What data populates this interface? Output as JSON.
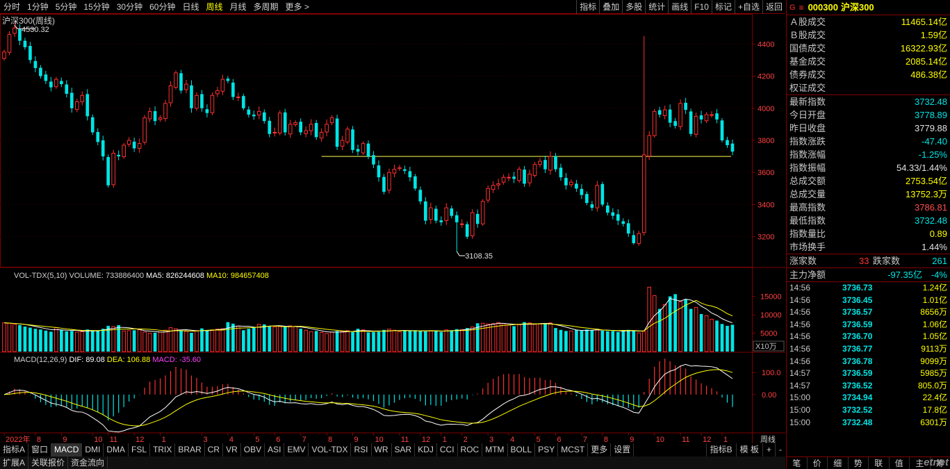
{
  "toolbar": {
    "periods": [
      "分时",
      "1分钟",
      "5分钟",
      "15分钟",
      "30分钟",
      "60分钟",
      "日线",
      "周线",
      "月线",
      "多周期",
      "更多 >"
    ],
    "active_period": "周线",
    "tools": [
      "指标",
      "叠加",
      "多股",
      "统计",
      "画线",
      "F10",
      "标记",
      "+自选",
      "返回"
    ]
  },
  "chart": {
    "title": "沪深300(周线)",
    "high_label": "4530.32",
    "low_label": "3108.35",
    "period_label": "周线",
    "unit_label": "X10万",
    "vol_legend": {
      "name": "VOL-TDX(5,10)",
      "volume": "VOLUME: 733886400",
      "ma5": "MA5: 826244608",
      "ma10": "MA10: 984657408"
    },
    "macd_legend": {
      "name": "MACD(12,26,9)",
      "dif": "DIF: 89.08",
      "dea": "DEA: 106.88",
      "macd": "MACD: -35.60"
    },
    "x_labels": [
      {
        "t": "2022年",
        "i": 0
      },
      {
        "t": "8",
        "i": 6
      },
      {
        "t": "9",
        "i": 11
      },
      {
        "t": "10",
        "i": 17
      },
      {
        "t": "11",
        "i": 20
      },
      {
        "t": "12",
        "i": 25
      },
      {
        "t": "1",
        "i": 30
      },
      {
        "t": "3",
        "i": 38
      },
      {
        "t": "4",
        "i": 43
      },
      {
        "t": "5",
        "i": 48
      },
      {
        "t": "6",
        "i": 52
      },
      {
        "t": "7",
        "i": 57
      },
      {
        "t": "8",
        "i": 62
      },
      {
        "t": "9",
        "i": 67
      },
      {
        "t": "10",
        "i": 71
      },
      {
        "t": "11",
        "i": 76
      },
      {
        "t": "12",
        "i": 80
      },
      {
        "t": "1",
        "i": 84
      },
      {
        "t": "2",
        "i": 88
      },
      {
        "t": "3",
        "i": 93
      },
      {
        "t": "4",
        "i": 97
      },
      {
        "t": "5",
        "i": 102
      },
      {
        "t": "6",
        "i": 106
      },
      {
        "t": "7",
        "i": 111
      },
      {
        "t": "8",
        "i": 115
      },
      {
        "t": "9",
        "i": 120
      },
      {
        "t": "10",
        "i": 125
      },
      {
        "t": "11",
        "i": 130
      },
      {
        "t": "12",
        "i": 134
      },
      {
        "t": "1",
        "i": 138
      }
    ],
    "price_ticks": [
      3200,
      3400,
      3600,
      3800,
      4000,
      4200,
      4400
    ],
    "vol_ticks": [
      5000,
      10000,
      15000
    ],
    "macd_ticks": [
      "0.00",
      "100.0"
    ]
  },
  "chart_data": {
    "type": "candlestick",
    "price_range": [
      3030,
      4570
    ],
    "closes": [
      4350,
      4460,
      4500,
      4420,
      4380,
      4300,
      4250,
      4200,
      4170,
      4130,
      4180,
      4150,
      4090,
      4000,
      4040,
      4080,
      3950,
      3850,
      3790,
      3700,
      3520,
      3720,
      3700,
      3770,
      3800,
      3750,
      3780,
      3940,
      3980,
      3920,
      3940,
      4030,
      4140,
      4220,
      4110,
      4150,
      4000,
      4080,
      4000,
      3970,
      4080,
      4110,
      4180,
      4170,
      4070,
      4070,
      4000,
      3960,
      3950,
      3980,
      3920,
      3840,
      3850,
      3970,
      3850,
      3900,
      3910,
      3850,
      3860,
      3900,
      3820,
      3850,
      3900,
      3940,
      3760,
      3800,
      3870,
      3740,
      3730,
      3780,
      3700,
      3650,
      3570,
      3480,
      3600,
      3620,
      3630,
      3610,
      3570,
      3500,
      3420,
      3300,
      3380,
      3300,
      3290,
      3380,
      3330,
      3290,
      3280,
      3200,
      3350,
      3280,
      3420,
      3500,
      3520,
      3530,
      3570,
      3570,
      3560,
      3620,
      3530,
      3590,
      3650,
      3670,
      3620,
      3700,
      3620,
      3570,
      3520,
      3540,
      3500,
      3460,
      3410,
      3380,
      3520,
      3400,
      3350,
      3330,
      3300,
      3280,
      3220,
      3160,
      3220,
      3710,
      3830,
      3980,
      3960,
      3990,
      3910,
      3890,
      4030,
      3990,
      3840,
      3950,
      3930,
      3960,
      3960,
      3930,
      3800,
      3770,
      3730
    ],
    "volumes": [
      7800,
      7700,
      7400,
      7200,
      6800,
      6500,
      6200,
      6000,
      5700,
      5400,
      6500,
      5900,
      5500,
      5600,
      5300,
      5400,
      6000,
      5800,
      5600,
      6200,
      7000,
      6800,
      7200,
      5600,
      5700,
      5800,
      5900,
      5300,
      5000,
      5100,
      5300,
      5800,
      6500,
      6200,
      5700,
      5500,
      5100,
      5700,
      6300,
      5800,
      5900,
      6100,
      6200,
      8000,
      7600,
      6900,
      5800,
      6200,
      6700,
      7400,
      7400,
      6900,
      6700,
      6800,
      6700,
      7000,
      6800,
      6200,
      5800,
      5400,
      5600,
      5200,
      4900,
      5300,
      5600,
      5500,
      5700,
      5300,
      6200,
      5900,
      5200,
      5300,
      5400,
      5900,
      6100,
      5800,
      5400,
      5600,
      5700,
      5800,
      5500,
      5500,
      5600,
      5700,
      5300,
      5900,
      5800,
      6100,
      6000,
      6400,
      6700,
      7700,
      7700,
      7500,
      7600,
      7900,
      7600,
      7200,
      6900,
      7300,
      8000,
      7800,
      7400,
      7500,
      7600,
      7800,
      6400,
      5900,
      5600,
      5600,
      5900,
      5700,
      6000,
      5800,
      6100,
      5700,
      5500,
      5600,
      5300,
      5800,
      5900,
      5700,
      5100,
      5500,
      17500,
      15200,
      11600,
      12800,
      15000,
      15600,
      13600,
      14200,
      11600,
      12000,
      10200,
      9800,
      8800,
      8400,
      7500,
      7000,
      7300
    ],
    "vol_range": [
      0,
      18500
    ],
    "macd_range": [
      -155,
      170
    ],
    "hline_price": 3700
  },
  "sidebar": {
    "code": "000300",
    "name": "沪深300",
    "rows1": [
      {
        "label": "Ａ股成交",
        "value": "11465.14亿",
        "color": "#ffff00"
      },
      {
        "label": "Ｂ股成交",
        "value": "1.59亿",
        "color": "#ffff00"
      },
      {
        "label": "国债成交",
        "value": "16322.93亿",
        "color": "#ffff00"
      },
      {
        "label": "基金成交",
        "value": "2085.14亿",
        "color": "#ffff00"
      },
      {
        "label": "债券成交",
        "value": "486.38亿",
        "color": "#ffff00"
      },
      {
        "label": "权证成交",
        "value": "",
        "color": "#ffff00"
      }
    ],
    "rows2": [
      {
        "label": "最新指数",
        "value": "3732.48",
        "color": "#00e5e5"
      },
      {
        "label": "今日开盘",
        "value": "3778.89",
        "color": "#00e5e5"
      },
      {
        "label": "昨日收盘",
        "value": "3779.88",
        "color": "#e0e0e0"
      },
      {
        "label": "指数涨跌",
        "value": "-47.40",
        "color": "#00e5e5"
      },
      {
        "label": "指数涨幅",
        "value": "-1.25%",
        "color": "#00e5e5"
      },
      {
        "label": "指数振幅",
        "value": "54.33/1.44%",
        "color": "#e0e0e0"
      },
      {
        "label": "总成交额",
        "value": "2753.54亿",
        "color": "#ffff00"
      },
      {
        "label": "总成交量",
        "value": "13752.3万",
        "color": "#ffff00"
      },
      {
        "label": "最高指数",
        "value": "3786.81",
        "color": "#ff5050"
      },
      {
        "label": "最低指数",
        "value": "3732.48",
        "color": "#00e5e5"
      },
      {
        "label": "指数量比",
        "value": "0.89",
        "color": "#ffff00"
      },
      {
        "label": "市场换手",
        "value": "1.44%",
        "color": "#e0e0e0"
      }
    ],
    "advance": {
      "up_label": "涨家数",
      "up": "33",
      "down_label": "跌家数",
      "down": "261"
    },
    "net_flow": {
      "label": "主力净额",
      "value": "-97.35亿",
      "pct": "-4%"
    },
    "ticks": [
      {
        "t": "14:56",
        "p": "3736.73",
        "v": "1.24亿"
      },
      {
        "t": "14:56",
        "p": "3736.45",
        "v": "1.01亿"
      },
      {
        "t": "14:56",
        "p": "3736.57",
        "v": "8656万"
      },
      {
        "t": "14:56",
        "p": "3736.59",
        "v": "1.06亿"
      },
      {
        "t": "14:56",
        "p": "3736.70",
        "v": "1.05亿"
      },
      {
        "t": "14:56",
        "p": "3736.77",
        "v": "9113万"
      },
      {
        "t": "14:56",
        "p": "3736.78",
        "v": "9099万"
      },
      {
        "t": "14:57",
        "p": "3736.59",
        "v": "5985万"
      },
      {
        "t": "14:57",
        "p": "3736.52",
        "v": "805.0万"
      },
      {
        "t": "15:00",
        "p": "3734.94",
        "v": "22.4亿"
      },
      {
        "t": "15:00",
        "p": "3732.52",
        "v": "17.8亿"
      },
      {
        "t": "15:00",
        "p": "3732.48",
        "v": "6301万"
      }
    ],
    "foot": [
      "笔",
      "价",
      "细",
      "势",
      "联",
      "值",
      "主",
      "筹"
    ],
    "watermark": "etnet"
  },
  "indicators": {
    "row1_left": "指标A",
    "row1": [
      "窗口",
      "MACD",
      "DMI",
      "DMA",
      "FSL",
      "TRIX",
      "BRAR",
      "CR",
      "VR",
      "OBV",
      "ASI",
      "EMV",
      "VOL-TDX",
      "RSI",
      "WR",
      "SAR",
      "KDJ",
      "CCI",
      "ROC",
      "MTM",
      "BOLL",
      "PSY",
      "MCST",
      "更多",
      "设置"
    ],
    "active": "MACD",
    "row1_right": [
      "指标B",
      "模 板",
      "+",
      "-"
    ],
    "row2": [
      "扩展A",
      "关联报价",
      "资金流向"
    ]
  },
  "colors": {
    "up": "#ff3030",
    "down": "#00e5e5",
    "ma1": "#ffffff",
    "ma2": "#ffff00",
    "border": "#800000",
    "hline": "#ffff50"
  }
}
